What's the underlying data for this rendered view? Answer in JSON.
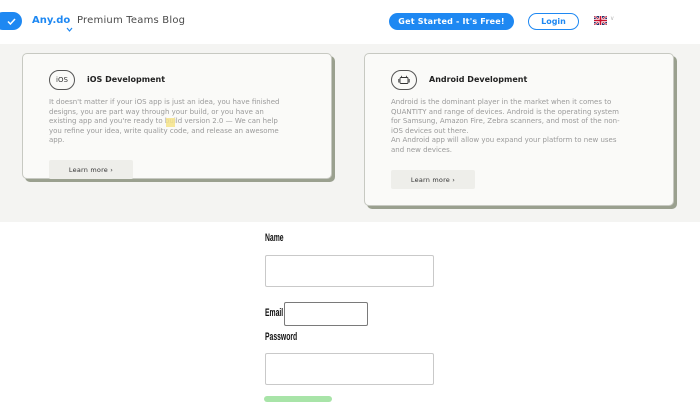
{
  "header": {
    "brand": "Any.do",
    "subtitle": "Premium Teams Blog",
    "get_started_label": "Get Started - It's Free!",
    "login_label": "Login",
    "lang_caret": "∨",
    "icons": {
      "logo": "checkmark-icon",
      "brand_menu": "chevron-down-icon",
      "language": "uk-flag-icon"
    }
  },
  "cards": [
    {
      "icon_label": "iOS",
      "title": "iOS Development",
      "lines": [
        "It doesn't matter if your iOS app is just an idea, you have finished",
        "designs, you are part way through your build, or you have an",
        "existing app and you're ready to build version 2.0 — We can help",
        "you refine your idea, write quality code, and release an awesome",
        "app."
      ],
      "learn_more": "Learn more ›"
    },
    {
      "icon_name": "android-icon",
      "title": "Android Development",
      "lines": [
        "Android is the dominant player in the market when it comes to",
        "QUANTITY and range of devices. Android is the operating system",
        "for Samsung, Amazon Fire, Zebra scanners, and most of the non-",
        "iOS devices out there.",
        "An Android app will allow you expand your platform to new uses",
        "and new devices."
      ],
      "learn_more": "Learn more ›"
    }
  ],
  "form": {
    "name_label": "Name",
    "email_label": "Email",
    "password_label": "Password"
  },
  "colors": {
    "accent": "#1e88f2",
    "section_bg": "#f4f4f2",
    "card_shadow": "#9aa08f"
  }
}
